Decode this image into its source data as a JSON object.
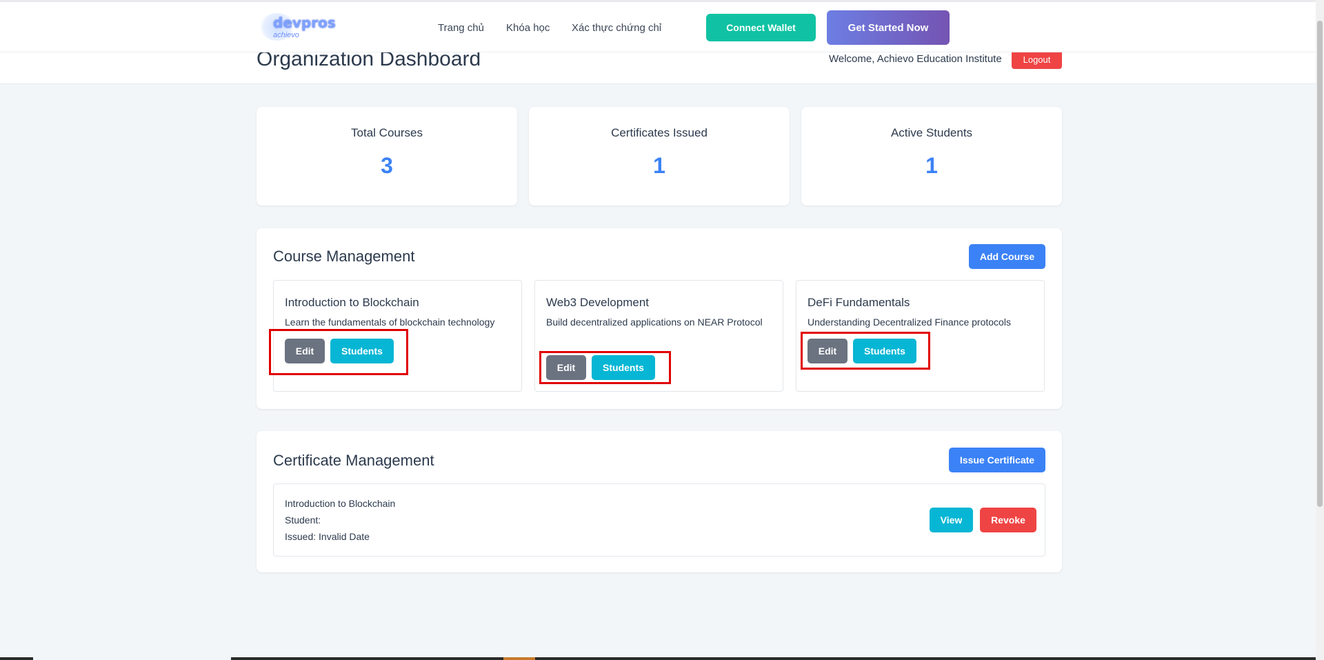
{
  "navbar": {
    "logo_text": "devpros",
    "logo_subtext": "achievo",
    "links": [
      "Trang chủ",
      "Khóa học",
      "Xác thực chứng chỉ"
    ],
    "connect_wallet_label": "Connect Wallet",
    "get_started_label": "Get Started Now"
  },
  "header": {
    "title": "Organization Dashboard",
    "welcome": "Welcome, Achievo Education Institute",
    "logout_label": "Logout"
  },
  "stats": [
    {
      "label": "Total Courses",
      "value": "3"
    },
    {
      "label": "Certificates Issued",
      "value": "1"
    },
    {
      "label": "Active Students",
      "value": "1"
    }
  ],
  "course_management": {
    "title": "Course Management",
    "add_course_label": "Add Course",
    "courses": [
      {
        "title": "Introduction to Blockchain",
        "description": "Learn the fundamentals of blockchain technology",
        "edit_label": "Edit",
        "students_label": "Students"
      },
      {
        "title": "Web3 Development",
        "description": "Build decentralized applications on NEAR Protocol",
        "edit_label": "Edit",
        "students_label": "Students"
      },
      {
        "title": "DeFi Fundamentals",
        "description": "Understanding Decentralized Finance protocols",
        "edit_label": "Edit",
        "students_label": "Students"
      }
    ]
  },
  "certificate_management": {
    "title": "Certificate Management",
    "issue_label": "Issue Certificate",
    "certificates": [
      {
        "course": "Introduction to Blockchain",
        "student": "Student:",
        "issued": "Issued: Invalid Date",
        "view_label": "View",
        "revoke_label": "Revoke"
      }
    ]
  },
  "colors": {
    "accent": "#3b82f6",
    "connect_wallet": "#10c2a3",
    "danger": "#ef4444",
    "secondary": "#6b7280",
    "info": "#06b6d4",
    "highlight": "#e00000"
  }
}
